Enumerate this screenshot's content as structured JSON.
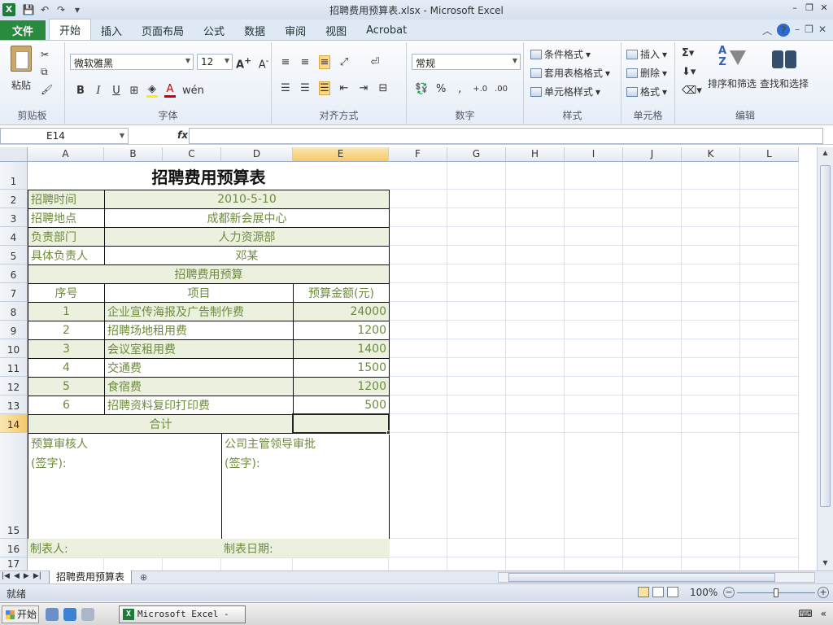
{
  "window": {
    "title": "招聘费用预算表.xlsx - Microsoft Excel"
  },
  "ribbon_tabs": [
    "文件",
    "开始",
    "插入",
    "页面布局",
    "公式",
    "数据",
    "审阅",
    "视图",
    "Acrobat"
  ],
  "ribbon": {
    "clipboard": {
      "paste": "粘贴",
      "label": "剪贴板"
    },
    "font": {
      "name": "微软雅黑",
      "size": "12",
      "label": "字体"
    },
    "alignment": {
      "label": "对齐方式"
    },
    "number": {
      "format": "常规",
      "label": "数字"
    },
    "styles": {
      "conditional": "条件格式",
      "table": "套用表格格式",
      "cell": "单元格样式",
      "label": "样式"
    },
    "cells": {
      "insert": "插入",
      "delete": "删除",
      "format": "格式",
      "label": "单元格"
    },
    "editing": {
      "sort": "排序和筛选",
      "find": "查找和选择",
      "label": "编辑"
    }
  },
  "formula_bar": {
    "name_box": "E14",
    "fx": "fx",
    "value": ""
  },
  "columns": [
    "A",
    "B",
    "C",
    "D",
    "E",
    "F",
    "G",
    "H",
    "I",
    "J",
    "K",
    "L"
  ],
  "rows": [
    "1",
    "2",
    "3",
    "4",
    "5",
    "6",
    "7",
    "8",
    "9",
    "10",
    "11",
    "12",
    "13",
    "14",
    "15",
    "16",
    "17"
  ],
  "sheet": {
    "title": "招聘费用预算表",
    "info": [
      {
        "label": "招聘时间",
        "value": "2010-5-10"
      },
      {
        "label": "招聘地点",
        "value": "成都新会展中心"
      },
      {
        "label": "负责部门",
        "value": "人力资源部"
      },
      {
        "label": "具体负责人",
        "value": "邓某"
      }
    ],
    "budget_header": "招聘费用预算",
    "table_headers": [
      "序号",
      "项目",
      "预算金额(元)"
    ],
    "items": [
      {
        "no": "1",
        "item": "企业宣传海报及广告制作费",
        "amount": "24000"
      },
      {
        "no": "2",
        "item": "招聘场地租用费",
        "amount": "1200"
      },
      {
        "no": "3",
        "item": "会议室租用费",
        "amount": "1400"
      },
      {
        "no": "4",
        "item": "交通费",
        "amount": "1500"
      },
      {
        "no": "5",
        "item": "食宿费",
        "amount": "1200"
      },
      {
        "no": "6",
        "item": "招聘资料复印打印费",
        "amount": "500"
      }
    ],
    "total_label": "合计",
    "total_value": "",
    "review_label": "预算审核人",
    "review_sign": "(签字):",
    "approve_label": "公司主管领导审批",
    "approve_sign": "(签字):",
    "maker_label": "制表人:",
    "date_label": "制表日期:"
  },
  "sheet_tab": "招聘费用预算表",
  "status": {
    "ready": "就绪",
    "zoom": "100%",
    "zoom_level_percent": 100
  },
  "taskbar": {
    "start": "开始",
    "task": "Microsoft Excel - ..."
  }
}
